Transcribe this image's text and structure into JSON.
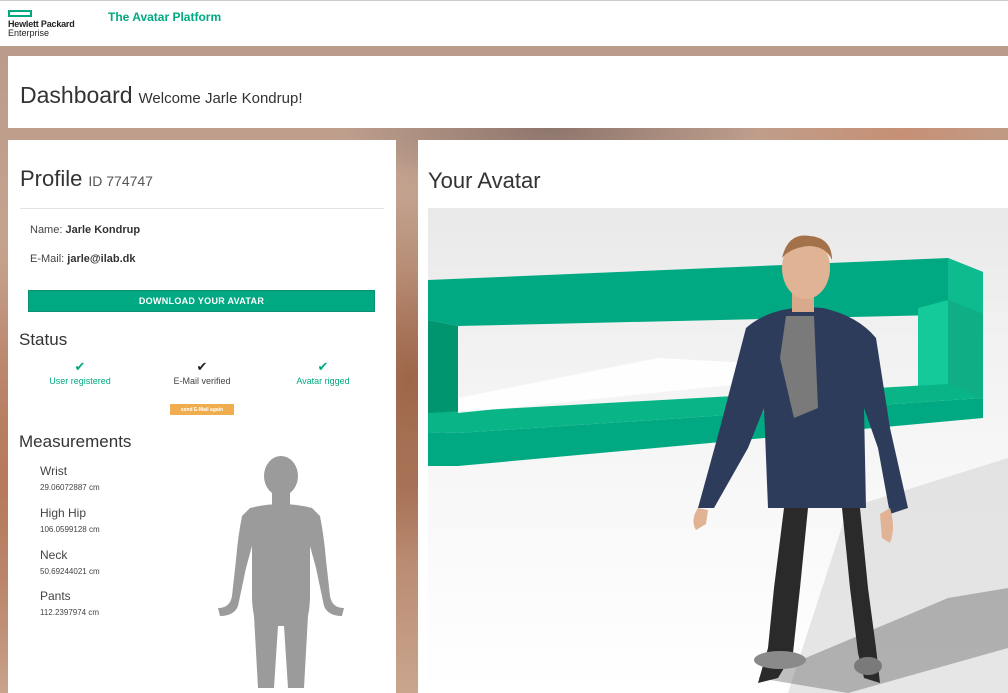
{
  "header": {
    "logo_line1": "Hewlett Packard",
    "logo_line2": "Enterprise",
    "platform_title": "The Avatar Platform"
  },
  "dashboard": {
    "title": "Dashboard",
    "welcome": "Welcome Jarle Kondrup!"
  },
  "profile": {
    "title": "Profile",
    "id": "ID 774747",
    "name_label": "Name:",
    "name_value": "Jarle Kondrup",
    "email_label": "E-Mail:",
    "email_value": "jarle@ilab.dk",
    "download_label": "DOWNLOAD YOUR AVATAR"
  },
  "status": {
    "title": "Status",
    "items": [
      {
        "label": "User registered",
        "state": "done"
      },
      {
        "label": "E-Mail verified",
        "state": "done"
      },
      {
        "label": "Avatar rigged",
        "state": "done"
      }
    ],
    "resend_label": "send E-Mail again"
  },
  "measurements": {
    "title": "Measurements",
    "items": [
      {
        "label": "Wrist",
        "value": "29.06072887 cm"
      },
      {
        "label": "High Hip",
        "value": "106.0599128 cm"
      },
      {
        "label": "Neck",
        "value": "50.69244021 cm"
      },
      {
        "label": "Pants",
        "value": "112.2397974 cm"
      }
    ]
  },
  "avatar": {
    "title": "Your Avatar"
  },
  "colors": {
    "brand": "#01a982",
    "warning": "#f0ad4e"
  },
  "icons": {
    "check": "check-icon",
    "silhouette": "body-silhouette-icon"
  }
}
